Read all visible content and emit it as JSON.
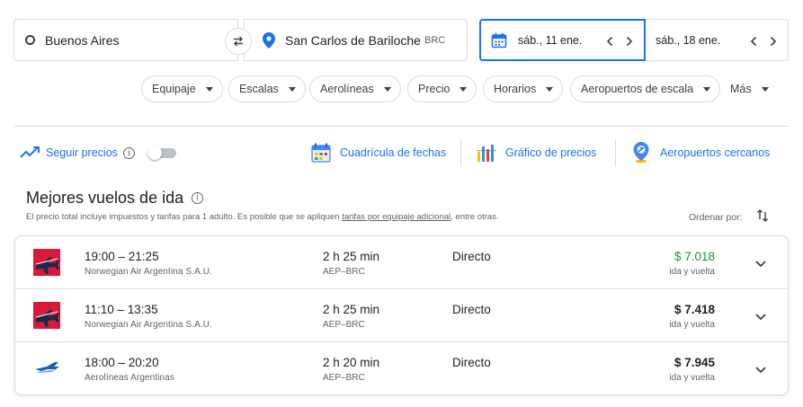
{
  "search": {
    "origin": "Buenos Aires",
    "destination": "San Carlos de Bariloche",
    "destination_code": "BRC",
    "depart_date": "sáb., 11 ene.",
    "return_date": "sáb., 18 ene."
  },
  "filters": [
    "Equipaje",
    "Escalas",
    "Aerolíneas",
    "Precio",
    "Horarios",
    "Aeropuertos de escala"
  ],
  "filters_more": "Más",
  "tools": {
    "track_prices": "Seguir precios",
    "date_grid": "Cuadrícula de fechas",
    "price_graph": "Gráfico de precios",
    "nearby_airports": "Aeropuertos cercanos"
  },
  "results": {
    "title": "Mejores vuelos de ida",
    "disclaimer_prefix": "El precio total incluye impuestos y tarifas para 1 adulto. Es posible que se apliquen ",
    "disclaimer_link": "tarifas por equipaje adicional",
    "disclaimer_suffix": ", entre otras.",
    "sort_label": "Ordenar por:"
  },
  "flights": [
    {
      "times": "19:00 – 21:25",
      "airline": "Norwegian Air Argentina S.A.U.",
      "logo": "norwegian",
      "duration": "2 h 25 min",
      "route": "AEP–BRC",
      "stops": "Directo",
      "price": "$ 7.018",
      "trip_type": "ida y vuelta",
      "price_color": "#1e8e3e"
    },
    {
      "times": "11:10 – 13:35",
      "airline": "Norwegian Air Argentina S.A.U.",
      "logo": "norwegian",
      "duration": "2 h 25 min",
      "route": "AEP–BRC",
      "stops": "Directo",
      "price": "$ 7.418",
      "trip_type": "ida y vuelta",
      "price_color": "#202124"
    },
    {
      "times": "18:00 – 20:20",
      "airline": "Aerolíneas Argentinas",
      "logo": "aerolineas",
      "duration": "2 h 20 min",
      "route": "AEP–BRC",
      "stops": "Directo",
      "price": "$ 7.945",
      "trip_type": "ida y vuelta",
      "price_color": "#202124"
    }
  ],
  "colors": {
    "accent": "#1a73e8",
    "border": "#dadce0",
    "price_low": "#1e8e3e",
    "norwegian_red": "#d81939",
    "aerolineas_blue": "#1a5fb4"
  },
  "icons": [
    "origin-ring-icon",
    "swap-icon",
    "location-pin-icon",
    "calendar-icon",
    "chevron-left-icon",
    "chevron-right-icon",
    "trend-icon",
    "info-icon",
    "date-grid-icon",
    "price-graph-icon",
    "nearby-airports-icon",
    "sort-icon",
    "expand-chevron-icon"
  ]
}
